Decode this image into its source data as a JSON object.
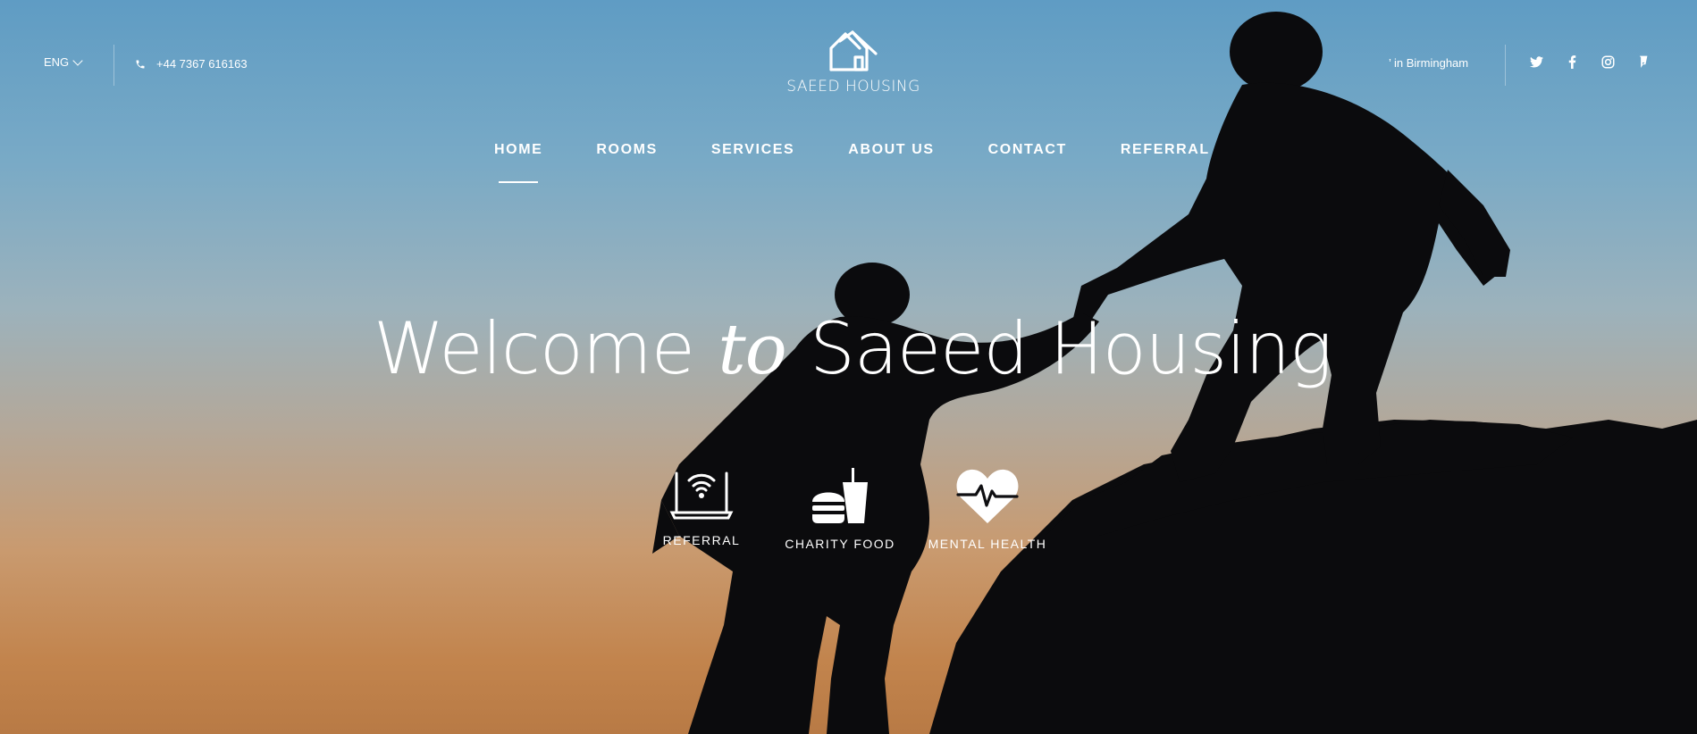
{
  "topbar": {
    "language": "ENG",
    "phone": "+44 7367 616163",
    "location": "’ in Birmingham"
  },
  "logo": {
    "brand": "SAEED HOUSING"
  },
  "nav": {
    "items": [
      "HOME",
      "ROOMS",
      "SERVICES",
      "ABOUT US",
      "CONTACT",
      "REFERRAL"
    ],
    "active": "HOME"
  },
  "hero": {
    "headline_part1": "Welcome",
    "headline_part2": "to",
    "headline_part3": "Saeed Housing"
  },
  "features": [
    {
      "label": "REFERRAL",
      "icon": "laptop-wifi-icon"
    },
    {
      "label": "CHARITY FOOD",
      "icon": "burger-drink-icon"
    },
    {
      "label": "MENTAL HEALTH",
      "icon": "heart-pulse-icon"
    }
  ],
  "socials": [
    "twitter-icon",
    "facebook-icon",
    "instagram-icon",
    "foursquare-icon"
  ]
}
